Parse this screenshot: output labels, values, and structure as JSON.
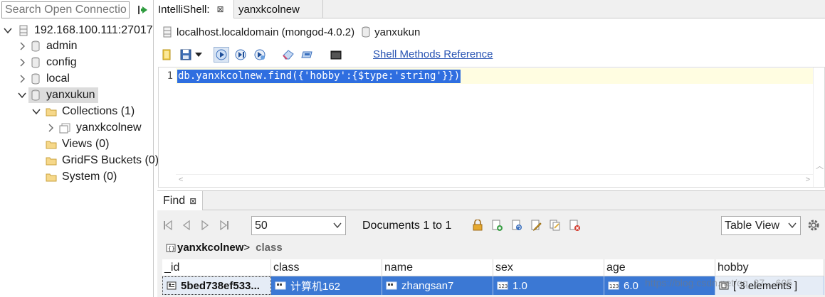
{
  "sidebar": {
    "search_placeholder": "Search Open Connectio",
    "connection": "192.168.100.111:27017",
    "databases": [
      "admin",
      "config",
      "local",
      "yanxukun"
    ],
    "collections_label": "Collections (1)",
    "collection_name": "yanxkcolnew",
    "views_label": "Views (0)",
    "gridfs_label": "GridFS Buckets (0)",
    "system_label": "System (0)"
  },
  "tabs": [
    {
      "label": "IntelliShell:",
      "close": "⊠"
    },
    {
      "label": "yanxkcolnew"
    }
  ],
  "context": {
    "host": "localhost.localdomain (mongod-4.0.2)",
    "database": "yanxukun"
  },
  "toolbar": {
    "shell_methods_link": "Shell Methods Reference"
  },
  "editor": {
    "line_number": "1",
    "code": "db.yanxkcolnew.find({'hobby':{$type:'string'}})"
  },
  "find": {
    "tab_label": "Find",
    "tab_close": "⊠",
    "page_size": "50",
    "documents_label": "Documents 1 to 1",
    "view_mode": "Table View",
    "breadcrumb_collection": "yanxkcolnew",
    "breadcrumb_sep": ">",
    "breadcrumb_field": "class",
    "columns": [
      "_id",
      "class",
      "name",
      "sex",
      "age",
      "hobby"
    ],
    "row": [
      "5bed738ef533...",
      "计算机162",
      "zhangsan7",
      "1.0",
      "6.0",
      "[ 3 elements ]"
    ]
  },
  "watermark": "https://blog.csdn.net/qq_37... 605",
  "colors": {
    "selection_blue": "#3b78d4",
    "code_highlight": "#2f6ee0",
    "link": "#2a55b3",
    "current_line": "#fffde1"
  }
}
